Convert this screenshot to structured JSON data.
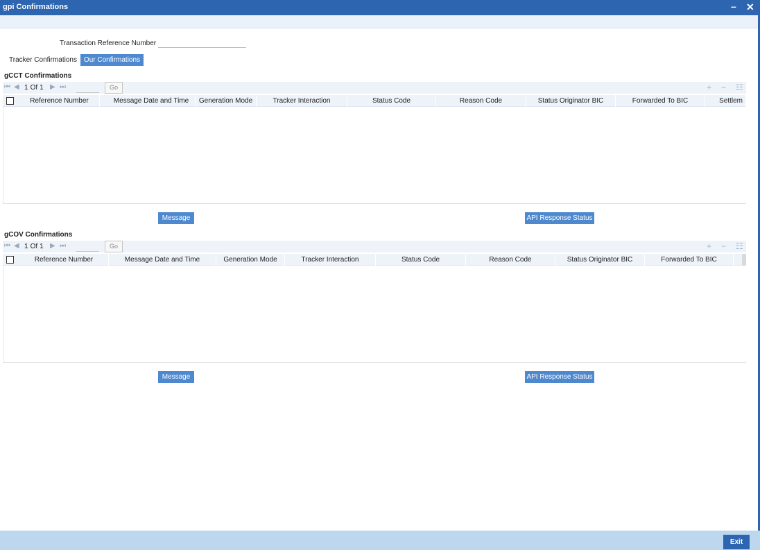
{
  "window": {
    "title": "gpi Confirmations",
    "minimize_glyph": "–",
    "close_glyph": "✕"
  },
  "form": {
    "trn_label": "Transaction Reference Number",
    "trn_value": ""
  },
  "tabs": [
    {
      "label": "Tracker Confirmations",
      "active": false
    },
    {
      "label": "Our Confirmations",
      "active": true
    }
  ],
  "gcct": {
    "title": "gCCT Confirmations",
    "pager": {
      "current": "1",
      "of_label": "Of",
      "total": "1",
      "go_label": "Go"
    },
    "columns": [
      "Reference Number",
      "Message Date and Time",
      "Generation Mode",
      "Tracker Interaction",
      "Status Code",
      "Reason Code",
      "Status Originator BIC",
      "Forwarded To BIC",
      "Settlem"
    ],
    "rows": [],
    "buttons": {
      "message": "Message",
      "api_status": "API Response Status"
    }
  },
  "gcov": {
    "title": "gCOV Confirmations",
    "pager": {
      "current": "1",
      "of_label": "Of",
      "total": "1",
      "go_label": "Go"
    },
    "columns": [
      "Reference Number",
      "Message Date and Time",
      "Generation Mode",
      "Tracker Interaction",
      "Status Code",
      "Reason Code",
      "Status Originator BIC",
      "Forwarded To BIC"
    ],
    "rows": [],
    "buttons": {
      "message": "Message",
      "api_status": "API Response Status"
    }
  },
  "footer": {
    "exit_label": "Exit"
  },
  "icons": {
    "first": "first-page-icon",
    "prev": "previous-page-icon",
    "next": "next-page-icon",
    "last": "last-page-icon",
    "add": "add-row-icon",
    "delete": "delete-row-icon",
    "columns": "column-settings-icon"
  },
  "colors": {
    "titlebar": "#2d65b0",
    "accent_button": "#4e88cf",
    "footer": "#bdd7ee",
    "header_bg": "#eef3f9"
  }
}
